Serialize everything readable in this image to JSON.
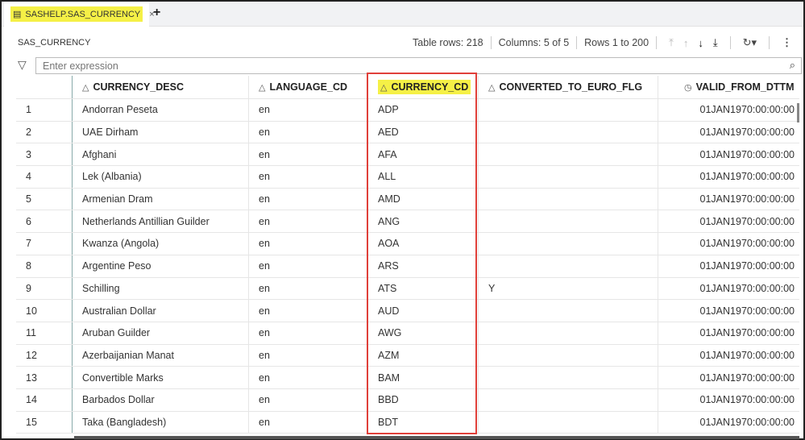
{
  "tab": {
    "label": "SASHELP.SAS_CURRENCY",
    "close": "×",
    "add": "+"
  },
  "table_name": "SAS_CURRENCY",
  "toolbar": {
    "table_rows": "Table rows: 218",
    "columns": "Columns: 5 of 5",
    "rows_range": "Rows 1 to 200"
  },
  "filter": {
    "placeholder": "Enter expression"
  },
  "columns": [
    "CURRENCY_DESC",
    "LANGUAGE_CD",
    "CURRENCY_CD",
    "CONVERTED_TO_EURO_FLG",
    "VALID_FROM_DTTM"
  ],
  "rows": [
    [
      "1",
      "Andorran Peseta",
      "en",
      "ADP",
      "",
      "01JAN1970:00:00:00"
    ],
    [
      "2",
      "UAE Dirham",
      "en",
      "AED",
      "",
      "01JAN1970:00:00:00"
    ],
    [
      "3",
      "Afghani",
      "en",
      "AFA",
      "",
      "01JAN1970:00:00:00"
    ],
    [
      "4",
      "Lek (Albania)",
      "en",
      "ALL",
      "",
      "01JAN1970:00:00:00"
    ],
    [
      "5",
      "Armenian Dram",
      "en",
      "AMD",
      "",
      "01JAN1970:00:00:00"
    ],
    [
      "6",
      "Netherlands Antillian Guilder",
      "en",
      "ANG",
      "",
      "01JAN1970:00:00:00"
    ],
    [
      "7",
      "Kwanza (Angola)",
      "en",
      "AOA",
      "",
      "01JAN1970:00:00:00"
    ],
    [
      "8",
      "Argentine Peso",
      "en",
      "ARS",
      "",
      "01JAN1970:00:00:00"
    ],
    [
      "9",
      "Schilling",
      "en",
      "ATS",
      "Y",
      "01JAN1970:00:00:00"
    ],
    [
      "10",
      "Australian Dollar",
      "en",
      "AUD",
      "",
      "01JAN1970:00:00:00"
    ],
    [
      "11",
      "Aruban Guilder",
      "en",
      "AWG",
      "",
      "01JAN1970:00:00:00"
    ],
    [
      "12",
      "Azerbaijanian Manat",
      "en",
      "AZM",
      "",
      "01JAN1970:00:00:00"
    ],
    [
      "13",
      "Convertible Marks",
      "en",
      "BAM",
      "",
      "01JAN1970:00:00:00"
    ],
    [
      "14",
      "Barbados Dollar",
      "en",
      "BBD",
      "",
      "01JAN1970:00:00:00"
    ],
    [
      "15",
      "Taka (Bangladesh)",
      "en",
      "BDT",
      "",
      "01JAN1970:00:00:00"
    ]
  ]
}
